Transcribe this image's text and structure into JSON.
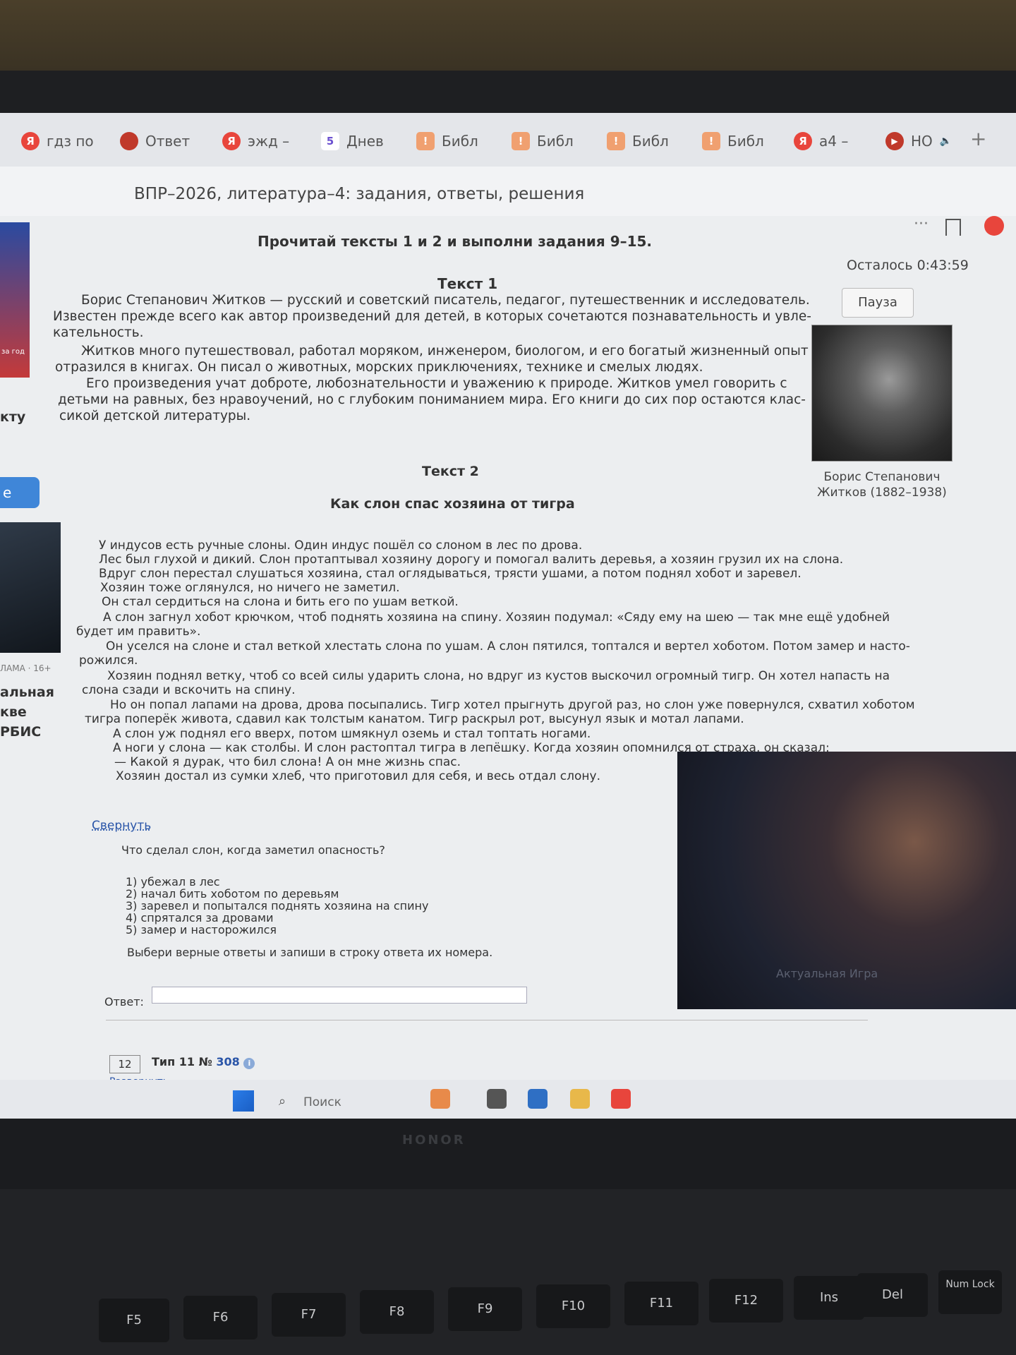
{
  "tabs": [
    {
      "icon": "Я",
      "label": "гдз по",
      "kind": "ya"
    },
    {
      "icon": "",
      "label": "Ответ",
      "kind": "rocket"
    },
    {
      "icon": "Я",
      "label": "эжд –",
      "kind": "ya"
    },
    {
      "icon": "5",
      "label": "Днев",
      "kind": "num"
    },
    {
      "icon": "!",
      "label": "Библ",
      "kind": "lib"
    },
    {
      "icon": "!",
      "label": "Библ",
      "kind": "lib"
    },
    {
      "icon": "!",
      "label": "Библ",
      "kind": "lib"
    },
    {
      "icon": "!",
      "label": "Библ",
      "kind": "lib"
    },
    {
      "icon": "Я",
      "label": "а4 – ",
      "kind": "ya"
    },
    {
      "icon": "",
      "label": "НО",
      "kind": "play"
    }
  ],
  "page": {
    "title": "ВПР–2026, литература–4: задания, ответы, решения"
  },
  "sidebar": {
    "ad_label": "за год",
    "text1": "кту",
    "button": "е",
    "age": "ЛАМА · 16+",
    "t1": "альная",
    "t2": "кве",
    "t3": "РБИС"
  },
  "timer": {
    "text": "Осталось 0:43:59",
    "pause": "Пауза"
  },
  "article": {
    "instruction": "Прочитай тексты 1 и 2 и выполни задания 9–15.",
    "text1_title": "Текст 1",
    "text1_lines": [
      "Борис Степанович Житков — русский и советский писатель, педагог, путешественник и исследователь.",
      "Известен прежде всего как автор произведений для детей, в которых сочетаются познавательность и увле-",
      "кательность.",
      "Житков много путешествовал, работал моряком, инженером, биологом, и его богатый жизненный опыт",
      "отразился в книгах. Он писал о животных, морских приключениях, технике и смелых людях.",
      "Его произведения учат доброте, любознательности и уважению к природе. Житков умел говорить с",
      "детьми на равных, без нравоучений, но с глубоким пониманием мира. Его книги до сих пор остаются клас-",
      "сикой детской литературы."
    ],
    "portrait_caption_1": "Борис Степанович",
    "portrait_caption_2": "Житков (1882–1938)",
    "text2_title": "Текст 2",
    "story_title": "Как слон спас хозяина от тигра",
    "story_lines": [
      "У индусов есть ручные слоны. Один индус пошёл со слоном в лес по дрова.",
      "Лес был глухой и дикий. Слон протаптывал хозяину дорогу и помогал валить деревья, а хозяин грузил их на слона.",
      "Вдруг слон перестал слушаться хозяина, стал оглядываться, трясти ушами, а потом поднял хобот и заревел.",
      "Хозяин тоже оглянулся, но ничего не заметил.",
      "Он стал сердиться на слона и бить его по ушам веткой.",
      "А слон загнул хобот крючком, чтоб поднять хозяина на спину. Хозяин подумал: «Сяду ему на шею — так мне ещё удобней",
      "будет им править».",
      "Он уселся на слоне и стал веткой хлестать слона по ушам. А слон пятился, топтался и вертел хоботом. Потом замер и насто-",
      "рожился.",
      "Хозяин поднял ветку, чтоб со всей силы ударить слона, но вдруг из кустов выскочил огромный тигр. Он хотел напасть на",
      "слона сзади и вскочить на спину.",
      "Но он попал лапами на дрова, дрова посыпались. Тигр хотел прыгнуть другой раз, но слон уже повернулся, схватил хоботом",
      "тигра поперёк живота, сдавил как толстым канатом. Тигр раскрыл рот, высунул язык и мотал лапами.",
      "А слон уж поднял его вверх, потом шмякнул оземь и стал топтать ногами.",
      "А ноги у слона — как столбы. И слон растоптал тигра в лепёшку. Когда хозяин опомнился от страха, он сказал:",
      "— Какой я дурак, что бил слона! А он мне жизнь спас.",
      "Хозяин достал из сумки хлеб, что приготовил для себя, и весь отдал слону."
    ],
    "collapse": "Свернуть"
  },
  "question": {
    "text": "Что сделал слон, когда заметил опасность?",
    "options": [
      "1) убежал в лес",
      "2) начал бить хоботом по деревьям",
      "3) заревел и попытался поднять хозяина на спину",
      "4) спрятался за дровами",
      "5) замер и насторожился"
    ],
    "instruction": "Выбери верные ответы и запиши в строку ответа их номера.",
    "answer_label": "Ответ:",
    "answer_value": ""
  },
  "next_task": {
    "number": "12",
    "type": "Тип 11 № ",
    "link": "308",
    "info": "i",
    "expand": "Развернуть"
  },
  "video": {
    "caption": "Актуальная Игра"
  },
  "taskbar": {
    "search": "Поиск"
  },
  "laptop": {
    "brand": "HONOR"
  },
  "keys": [
    "F5",
    "F6",
    "F7",
    "F8",
    "F9",
    "F10",
    "F11",
    "F12",
    "Ins",
    "Del",
    "Num Lock"
  ],
  "colors": {
    "link": "#2a55a8",
    "yandex": "#e8453c",
    "timer_text": "#444444"
  }
}
